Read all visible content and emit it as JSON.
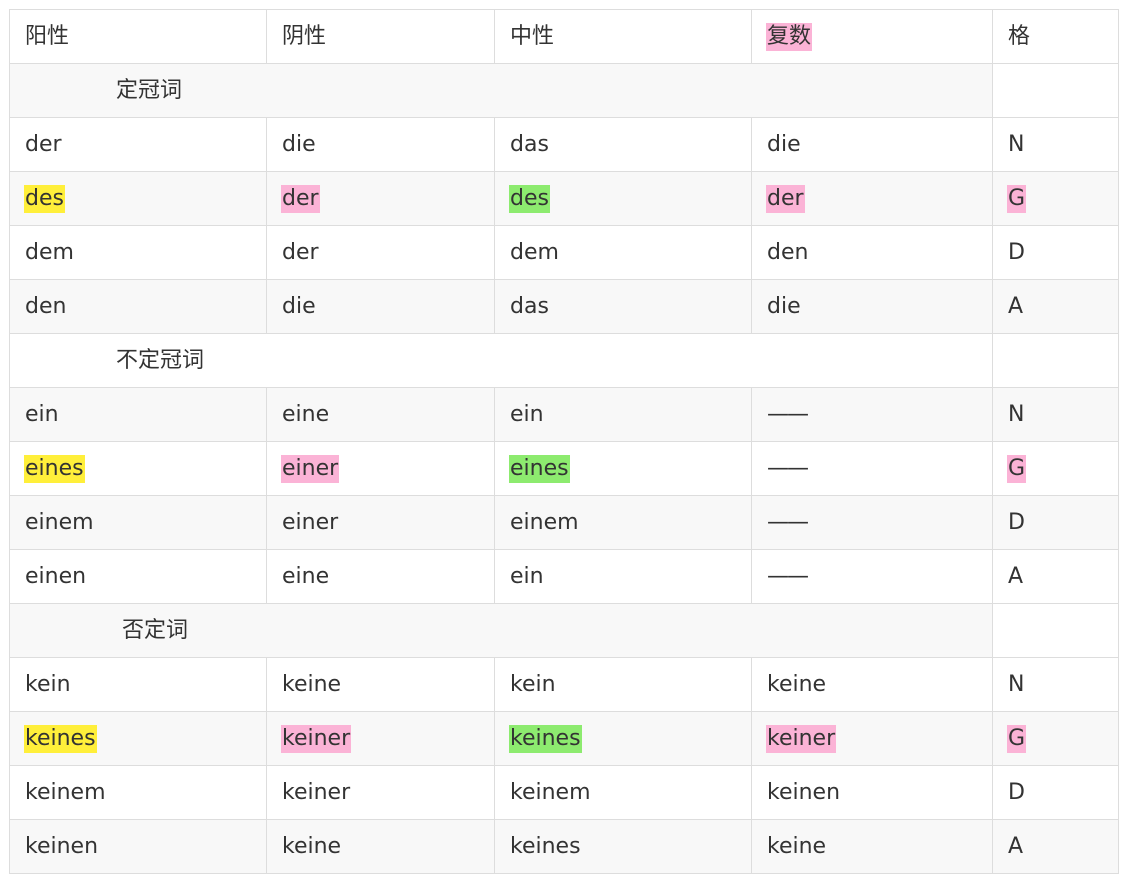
{
  "header": {
    "cells": [
      {
        "text": "阳性"
      },
      {
        "text": "阴性"
      },
      {
        "text": "中性"
      },
      {
        "text": "复数",
        "highlight": "pink"
      },
      {
        "text": "格"
      }
    ]
  },
  "sections": [
    {
      "title": "定冠词",
      "rows": [
        {
          "cells": [
            {
              "text": "der"
            },
            {
              "text": "die"
            },
            {
              "text": "das"
            },
            {
              "text": "die"
            },
            {
              "text": "N"
            }
          ]
        },
        {
          "cells": [
            {
              "text": "des",
              "highlight": "yellow"
            },
            {
              "text": "der",
              "highlight": "pink"
            },
            {
              "text": "des",
              "highlight": "green"
            },
            {
              "text": "der",
              "highlight": "pink"
            },
            {
              "text": "G",
              "highlight": "pink"
            }
          ]
        },
        {
          "cells": [
            {
              "text": "dem"
            },
            {
              "text": "der"
            },
            {
              "text": "dem"
            },
            {
              "text": "den"
            },
            {
              "text": "D"
            }
          ]
        },
        {
          "cells": [
            {
              "text": "den"
            },
            {
              "text": "die"
            },
            {
              "text": "das"
            },
            {
              "text": "die"
            },
            {
              "text": "A"
            }
          ]
        }
      ]
    },
    {
      "title": "不定冠词",
      "rows": [
        {
          "cells": [
            {
              "text": "ein"
            },
            {
              "text": "eine"
            },
            {
              "text": "ein"
            },
            {
              "text": "——"
            },
            {
              "text": "N"
            }
          ]
        },
        {
          "cells": [
            {
              "text": "eines",
              "highlight": "yellow"
            },
            {
              "text": "einer",
              "highlight": "pink"
            },
            {
              "text": "eines",
              "highlight": "green"
            },
            {
              "text": "——"
            },
            {
              "text": "G",
              "highlight": "pink"
            }
          ]
        },
        {
          "cells": [
            {
              "text": "einem"
            },
            {
              "text": "einer"
            },
            {
              "text": "einem"
            },
            {
              "text": "——"
            },
            {
              "text": "D"
            }
          ]
        },
        {
          "cells": [
            {
              "text": "einen"
            },
            {
              "text": "eine"
            },
            {
              "text": "ein"
            },
            {
              "text": "——"
            },
            {
              "text": "A"
            }
          ]
        }
      ]
    },
    {
      "title": "否定词",
      "rows": [
        {
          "cells": [
            {
              "text": "kein"
            },
            {
              "text": "keine"
            },
            {
              "text": "kein"
            },
            {
              "text": "keine"
            },
            {
              "text": "N"
            }
          ]
        },
        {
          "cells": [
            {
              "text": "keines",
              "highlight": "yellow"
            },
            {
              "text": "keiner",
              "highlight": "pink"
            },
            {
              "text": "keines",
              "highlight": "green"
            },
            {
              "text": "keiner",
              "highlight": "pink"
            },
            {
              "text": "G",
              "highlight": "pink"
            }
          ]
        },
        {
          "cells": [
            {
              "text": "keinem"
            },
            {
              "text": "keiner"
            },
            {
              "text": "keinem"
            },
            {
              "text": "keinen"
            },
            {
              "text": "D"
            }
          ]
        },
        {
          "cells": [
            {
              "text": "keinen"
            },
            {
              "text": "keine"
            },
            {
              "text": "keines"
            },
            {
              "text": "keine"
            },
            {
              "text": "A"
            }
          ]
        }
      ]
    }
  ],
  "colors": {
    "yellow": "#ffef3a",
    "pink": "#fbb3d6",
    "green": "#8deb6f",
    "border": "#dddddd",
    "stripe": "#f8f8f8",
    "text": "#333333"
  }
}
